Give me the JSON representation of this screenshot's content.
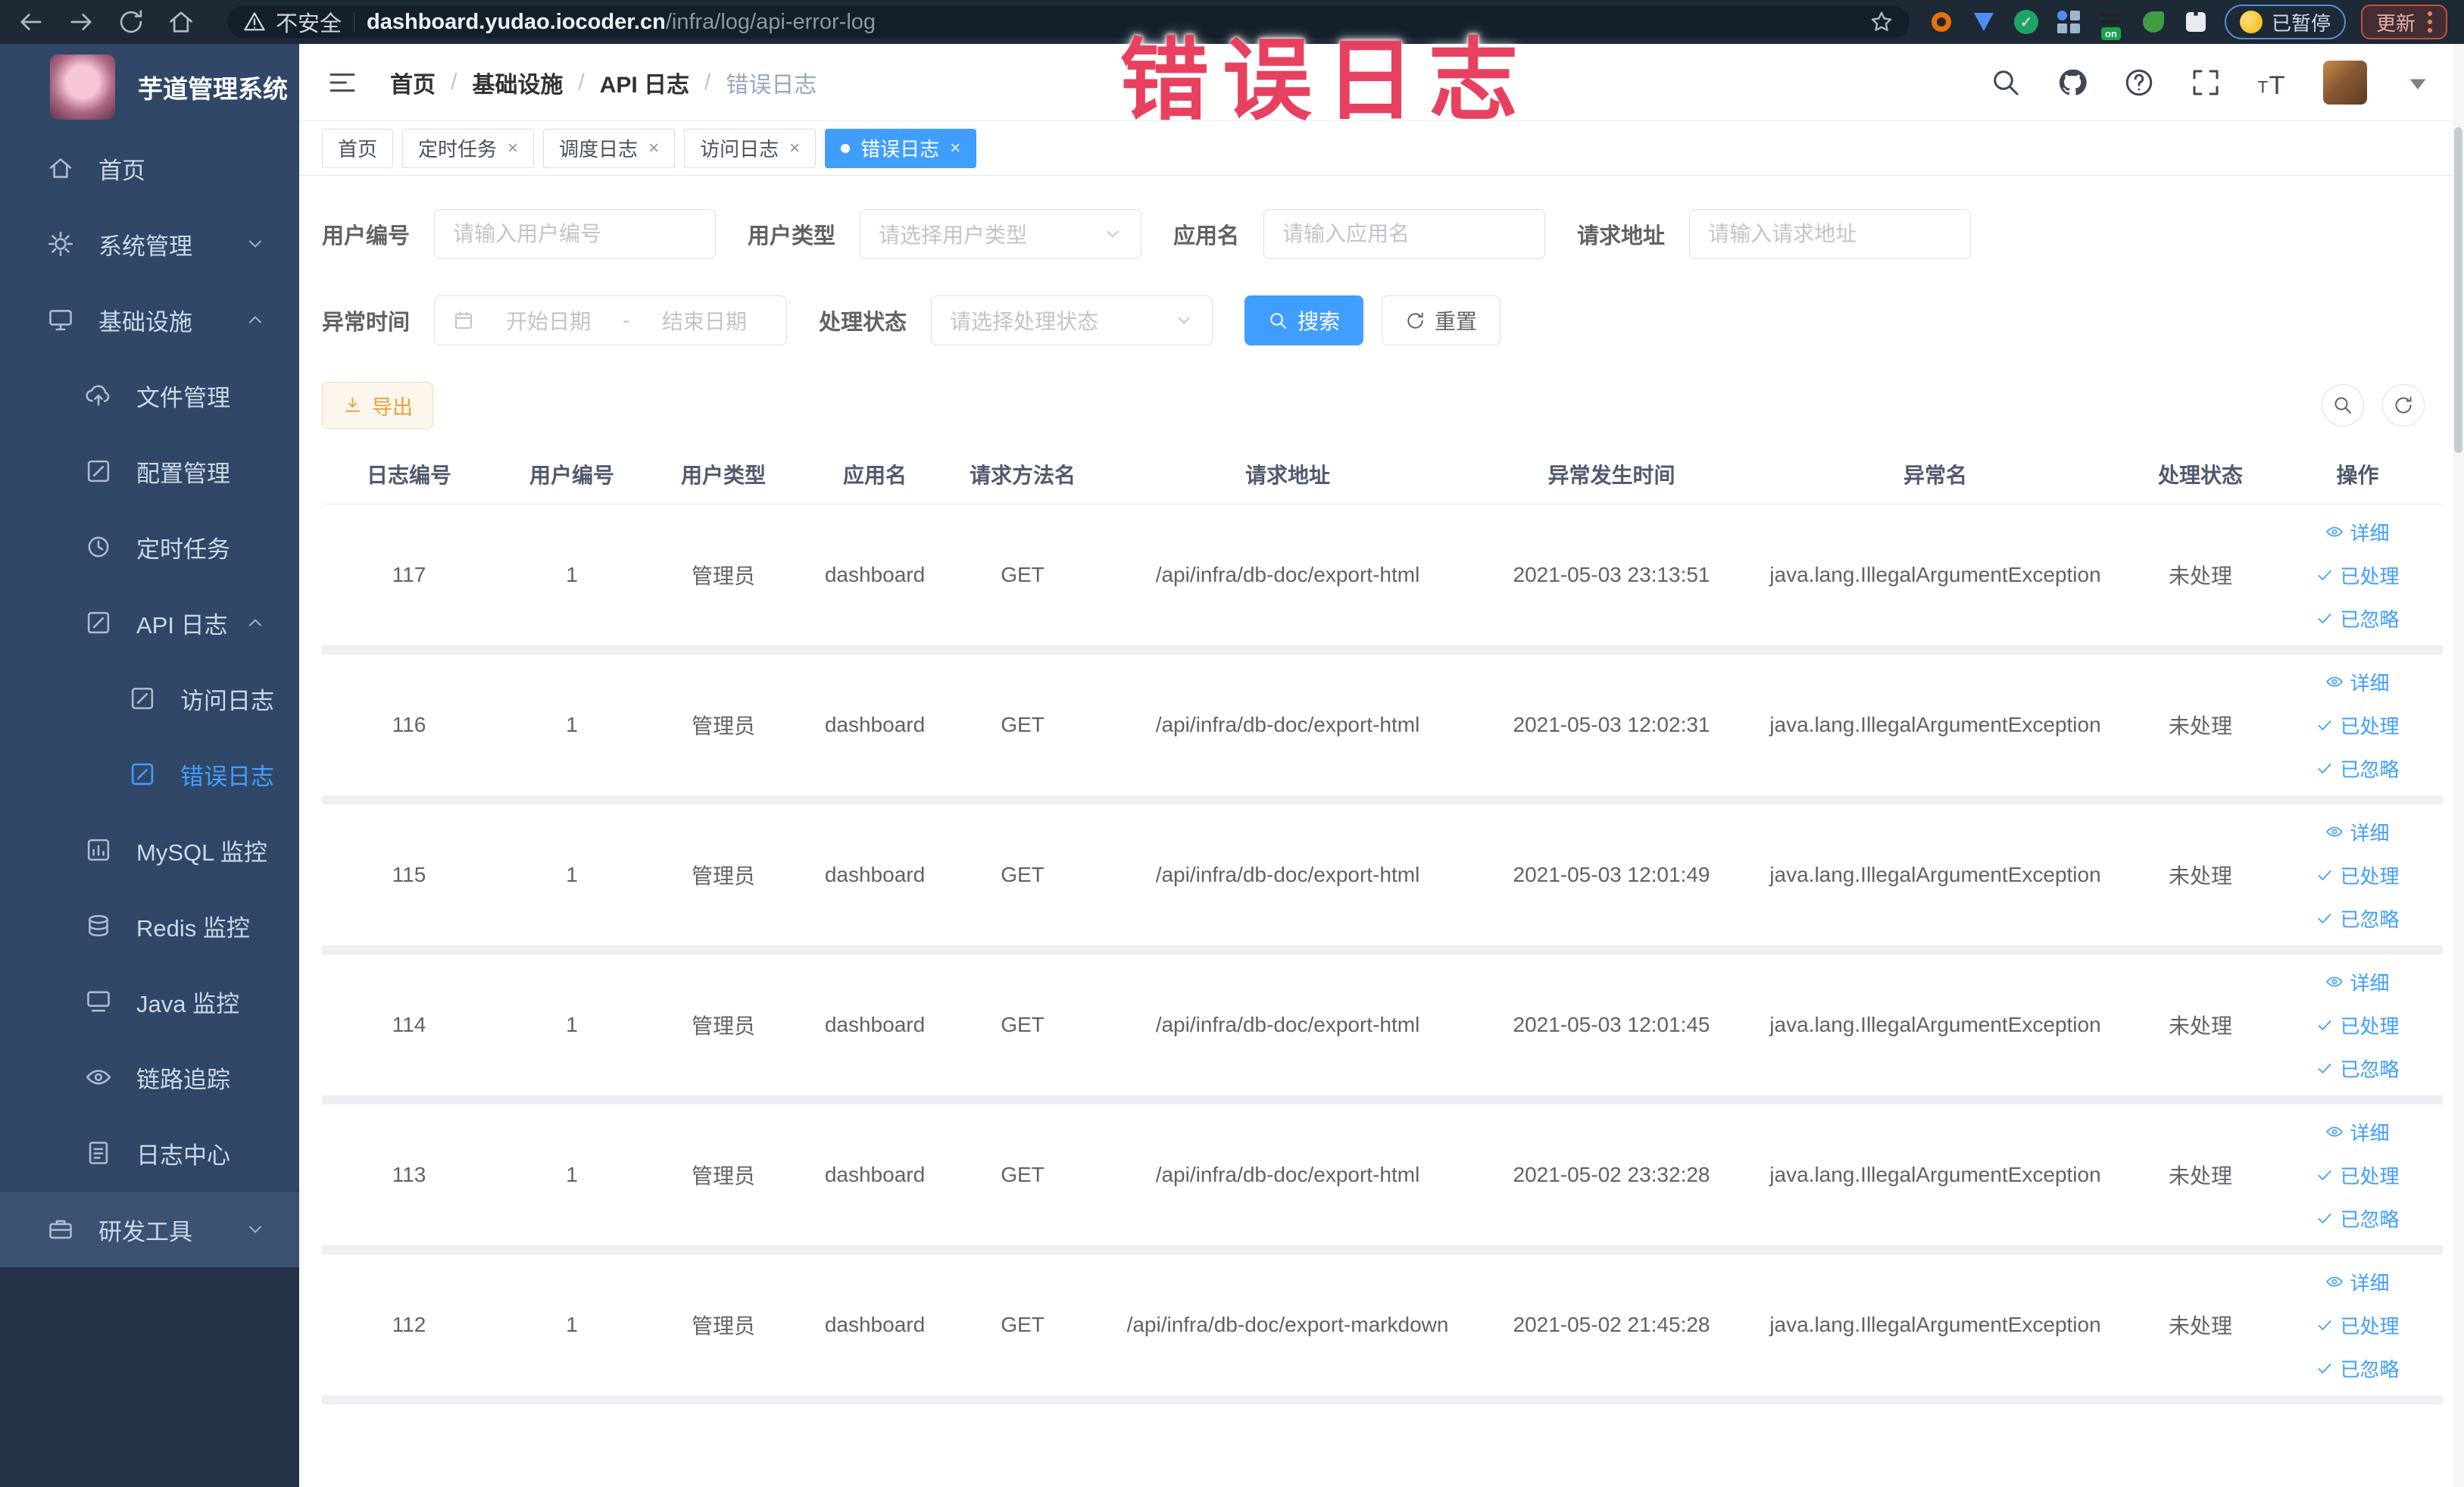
{
  "browser": {
    "security_label": "不安全",
    "url_domain": "dashboard.yudao.iocoder.cn",
    "url_path": "/infra/log/api-error-log",
    "paused_label": "已暂停",
    "update_label": "更新"
  },
  "overlay": {
    "text": "错误日志",
    "color": "#e8415f"
  },
  "sidebar": {
    "title": "芋道管理系统",
    "items": [
      {
        "key": "home",
        "label": "首页",
        "icon": "home-icon",
        "level": 1,
        "arrow": null,
        "active": false
      },
      {
        "key": "system",
        "label": "系统管理",
        "icon": "gear-icon",
        "level": 1,
        "arrow": "down",
        "active": false
      },
      {
        "key": "infra",
        "label": "基础设施",
        "icon": "monitor-icon",
        "level": 1,
        "arrow": "up",
        "active": false
      },
      {
        "key": "file",
        "label": "文件管理",
        "icon": "upload-icon",
        "level": 2,
        "arrow": null,
        "active": false
      },
      {
        "key": "config",
        "label": "配置管理",
        "icon": "edit-icon",
        "level": 2,
        "arrow": null,
        "active": false
      },
      {
        "key": "job",
        "label": "定时任务",
        "icon": "time-icon",
        "level": 2,
        "arrow": null,
        "active": false
      },
      {
        "key": "api-log",
        "label": "API 日志",
        "icon": "edit-icon",
        "level": 2,
        "arrow": "up",
        "active": false
      },
      {
        "key": "access-log",
        "label": "访问日志",
        "icon": "edit-icon",
        "level": 3,
        "arrow": null,
        "active": false
      },
      {
        "key": "error-log",
        "label": "错误日志",
        "icon": "edit-icon",
        "level": 3,
        "arrow": null,
        "active": true
      },
      {
        "key": "mysql",
        "label": "MySQL 监控",
        "icon": "chart-icon",
        "level": 2,
        "arrow": null,
        "active": false
      },
      {
        "key": "redis",
        "label": "Redis 监控",
        "icon": "redis-icon",
        "level": 2,
        "arrow": null,
        "active": false
      },
      {
        "key": "java",
        "label": "Java 监控",
        "icon": "java-icon",
        "level": 2,
        "arrow": null,
        "active": false
      },
      {
        "key": "trace",
        "label": "链路追踪",
        "icon": "eye-icon",
        "level": 2,
        "arrow": null,
        "active": false
      },
      {
        "key": "log-center",
        "label": "日志中心",
        "icon": "doc-icon",
        "level": 2,
        "arrow": null,
        "active": false
      }
    ],
    "devtools": {
      "key": "devtools",
      "label": "研发工具",
      "icon": "tool-icon",
      "level": 1,
      "arrow": "down",
      "active": false
    }
  },
  "header": {
    "breadcrumb": [
      "首页",
      "基础设施",
      "API 日志",
      "错误日志"
    ]
  },
  "tabs": [
    {
      "label": "首页",
      "closable": false,
      "active": false
    },
    {
      "label": "定时任务",
      "closable": true,
      "active": false
    },
    {
      "label": "调度日志",
      "closable": true,
      "active": false
    },
    {
      "label": "访问日志",
      "closable": true,
      "active": false
    },
    {
      "label": "错误日志",
      "closable": true,
      "active": true
    }
  ],
  "filters": {
    "user_id": {
      "label": "用户编号",
      "placeholder": "请输入用户编号"
    },
    "user_type": {
      "label": "用户类型",
      "placeholder": "请选择用户类型"
    },
    "app_name": {
      "label": "应用名",
      "placeholder": "请输入应用名"
    },
    "request_url": {
      "label": "请求地址",
      "placeholder": "请输入请求地址"
    },
    "exception_time": {
      "label": "异常时间",
      "start_placeholder": "开始日期",
      "separator": "-",
      "end_placeholder": "结束日期"
    },
    "process_status": {
      "label": "处理状态",
      "placeholder": "请选择处理状态"
    },
    "search_label": "搜索",
    "reset_label": "重置"
  },
  "toolbar": {
    "export_label": "导出"
  },
  "table": {
    "columns": [
      "日志编号",
      "用户编号",
      "用户类型",
      "应用名",
      "请求方法名",
      "请求地址",
      "异常发生时间",
      "异常名",
      "处理状态",
      "操作"
    ],
    "rows": [
      [
        "117",
        "1",
        "管理员",
        "dashboard",
        "GET",
        "/api/infra/db-doc/export-html",
        "2021-05-03 23:13:51",
        "java.lang.IllegalArgumentException",
        "未处理"
      ],
      [
        "116",
        "1",
        "管理员",
        "dashboard",
        "GET",
        "/api/infra/db-doc/export-html",
        "2021-05-03 12:02:31",
        "java.lang.IllegalArgumentException",
        "未处理"
      ],
      [
        "115",
        "1",
        "管理员",
        "dashboard",
        "GET",
        "/api/infra/db-doc/export-html",
        "2021-05-03 12:01:49",
        "java.lang.IllegalArgumentException",
        "未处理"
      ],
      [
        "114",
        "1",
        "管理员",
        "dashboard",
        "GET",
        "/api/infra/db-doc/export-html",
        "2021-05-03 12:01:45",
        "java.lang.IllegalArgumentException",
        "未处理"
      ],
      [
        "113",
        "1",
        "管理员",
        "dashboard",
        "GET",
        "/api/infra/db-doc/export-html",
        "2021-05-02 23:32:28",
        "java.lang.IllegalArgumentException",
        "未处理"
      ],
      [
        "112",
        "1",
        "管理员",
        "dashboard",
        "GET",
        "/api/infra/db-doc/export-markdown",
        "2021-05-02 21:45:28",
        "java.lang.IllegalArgumentException",
        "未处理"
      ]
    ],
    "row_actions": [
      "详细",
      "已处理",
      "已忽略"
    ]
  },
  "colors": {
    "accent": "#409eff",
    "warning": "#e6a23c",
    "overlay_red": "#e8415f"
  }
}
